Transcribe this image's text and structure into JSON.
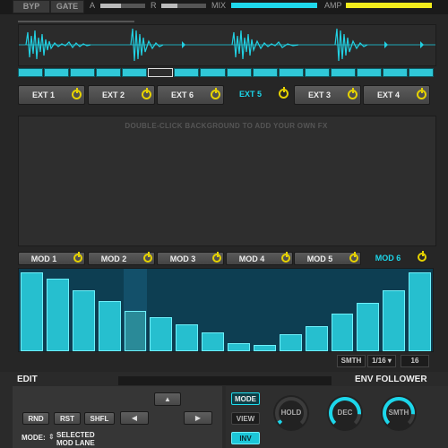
{
  "top": {
    "byp": "BYP",
    "gate": "GATE",
    "a_label": "A",
    "r_label": "R",
    "mix_label": "MIX",
    "amp_label": "AMP",
    "a_level": 0.45,
    "r_level": 0.35,
    "mix_level": 1.0,
    "amp_level": 1.0,
    "mix_color": "#1fd8ec",
    "amp_color": "#f2ec1c"
  },
  "sequencer": {
    "segments": 16,
    "selected_index": 5
  },
  "ext_buttons": [
    {
      "label": "EXT 1",
      "active": false
    },
    {
      "label": "EXT 2",
      "active": false
    },
    {
      "label": "EXT 6",
      "active": false
    },
    {
      "label": "EXT 5",
      "active": true
    },
    {
      "label": "EXT 3",
      "active": false
    },
    {
      "label": "EXT 4",
      "active": false
    }
  ],
  "fx_hint": "DOUBLE-CLICK BACKGROUND TO ADD YOUR OWN FX",
  "mod_buttons": [
    {
      "label": "MOD 1",
      "active": false
    },
    {
      "label": "MOD 2",
      "active": false
    },
    {
      "label": "MOD 3",
      "active": false
    },
    {
      "label": "MOD 4",
      "active": false
    },
    {
      "label": "MOD 5",
      "active": false
    },
    {
      "label": "MOD 6",
      "active": true
    }
  ],
  "mod_lane": {
    "values": [
      0.98,
      0.9,
      0.76,
      0.62,
      0.5,
      0.42,
      0.33,
      0.23,
      0.1,
      0.08,
      0.21,
      0.31,
      0.47,
      0.6,
      0.76,
      0.98
    ],
    "selected_index": 4
  },
  "mod_controls": {
    "smth": "SMTH",
    "rate": "1/16",
    "steps": "16"
  },
  "edit": {
    "title": "EDIT",
    "rnd": "RND",
    "rst": "RST",
    "shfl": "SHFL",
    "mode_label": "MODE:",
    "mode_value_1": "SELECTED",
    "mode_value_2": "MOD LANE",
    "arrows": {
      "up": "▲",
      "left": "◀",
      "right": "▶"
    }
  },
  "env": {
    "title": "ENV FOLLOWER",
    "mode": "MODE",
    "view": "VIEW",
    "inv": "INV",
    "knobs": [
      {
        "label": "HOLD",
        "level": 0.05
      },
      {
        "label": "DEC",
        "level": 0.85
      },
      {
        "label": "SMTH",
        "level": 0.85
      }
    ]
  }
}
